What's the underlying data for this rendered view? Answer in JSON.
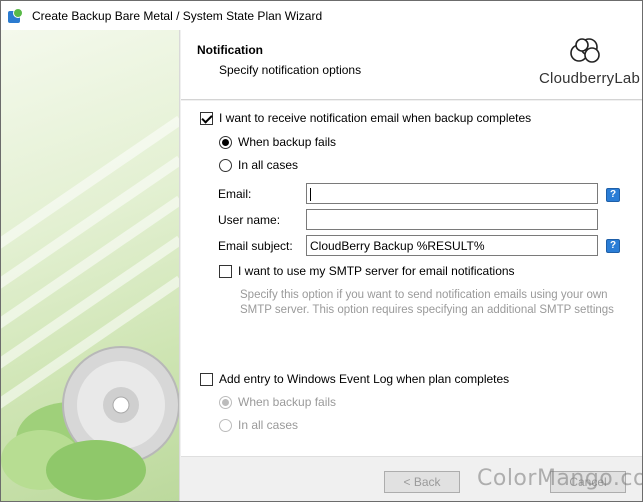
{
  "window": {
    "title": "Create Backup Bare Metal / System State Plan Wizard"
  },
  "header": {
    "title": "Notification",
    "subtitle": "Specify notification options",
    "logo_text": "CloudberryLab"
  },
  "notification": {
    "email_checkbox_label": "I want to receive notification email when backup completes",
    "email_checkbox_checked": true,
    "radio_fails_label": "When backup fails",
    "radio_all_label": "In all cases",
    "selected_radio": "fails"
  },
  "fields": {
    "email_label": "Email:",
    "email_value": "",
    "username_label": "User name:",
    "username_value": "",
    "subject_label": "Email subject:",
    "subject_value": "CloudBerry Backup %RESULT%",
    "help_glyph": "?"
  },
  "smtp": {
    "checkbox_label": "I want to use my SMTP server for email notifications",
    "checkbox_checked": false,
    "description": "Specify this option if you want to send notification emails using your own SMTP server. This option requires specifying an additional SMTP settings"
  },
  "event_log": {
    "checkbox_label": "Add entry to Windows Event Log when plan completes",
    "checkbox_checked": false,
    "radio_fails_label": "When backup fails",
    "radio_all_label": "In all cases"
  },
  "footer": {
    "back_label": "< Back",
    "next_label": "Cancel",
    "watermark": "ColorMango.com"
  },
  "colors": {
    "sidebar_green": "#cfe5b4",
    "help_blue": "#2a7dd6",
    "disabled_text": "#9a9a9a"
  }
}
